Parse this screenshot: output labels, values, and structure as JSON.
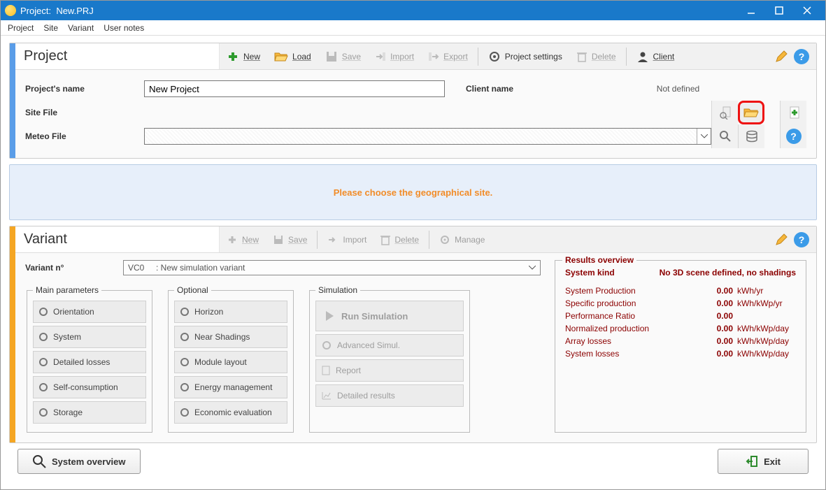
{
  "titlebar": {
    "prefix": "Project:",
    "filename": "New.PRJ"
  },
  "menu": {
    "project": "Project",
    "site": "Site",
    "variant": "Variant",
    "usernotes": "User notes"
  },
  "projectPanel": {
    "heading": "Project",
    "toolbar": {
      "new": "New",
      "load": "Load",
      "save": "Save",
      "import": "Import",
      "export": "Export",
      "settings": "Project settings",
      "delete": "Delete",
      "client": "Client"
    },
    "fields": {
      "name_label": "Project's name",
      "name_value": "New Project",
      "client_label": "Client name",
      "client_value": "Not defined",
      "site_label": "Site File",
      "meteo_label": "Meteo File"
    }
  },
  "hint": "Please choose the geographical site.",
  "variantPanel": {
    "heading": "Variant",
    "toolbar": {
      "new": "New",
      "save": "Save",
      "import": "Import",
      "delete": "Delete",
      "manage": "Manage"
    },
    "variant_no_label": "Variant n°",
    "variant_combo_code": "VC0",
    "variant_combo_text": ": New simulation variant",
    "groups": {
      "main": {
        "legend": "Main parameters",
        "items": {
          "orientation": "Orientation",
          "system": "System",
          "detailed": "Detailed losses",
          "self": "Self-consumption",
          "storage": "Storage"
        }
      },
      "optional": {
        "legend": "Optional",
        "items": {
          "horizon": "Horizon",
          "near": "Near Shadings",
          "module": "Module layout",
          "energy": "Energy management",
          "economic": "Economic evaluation"
        }
      },
      "simulation": {
        "legend": "Simulation",
        "run": "Run Simulation",
        "advanced": "Advanced Simul.",
        "report": "Report",
        "detailed": "Detailed results"
      }
    },
    "results": {
      "legend": "Results overview",
      "system_kind_label": "System kind",
      "system_kind_note": "No 3D scene defined, no shadings",
      "rows": {
        "sysprod": {
          "label": "System Production",
          "value": "0.00",
          "unit": "kWh/yr"
        },
        "specprod": {
          "label": "Specific production",
          "value": "0.00",
          "unit": "kWh/kWp/yr"
        },
        "perf": {
          "label": "Performance Ratio",
          "value": "0.00",
          "unit": ""
        },
        "normprod": {
          "label": "Normalized production",
          "value": "0.00",
          "unit": "kWh/kWp/day"
        },
        "array": {
          "label": "Array losses",
          "value": "0.00",
          "unit": "kWh/kWp/day"
        },
        "sysloss": {
          "label": "System losses",
          "value": "0.00",
          "unit": "kWh/kWp/day"
        }
      }
    }
  },
  "footer": {
    "overview": "System overview",
    "exit": "Exit"
  }
}
